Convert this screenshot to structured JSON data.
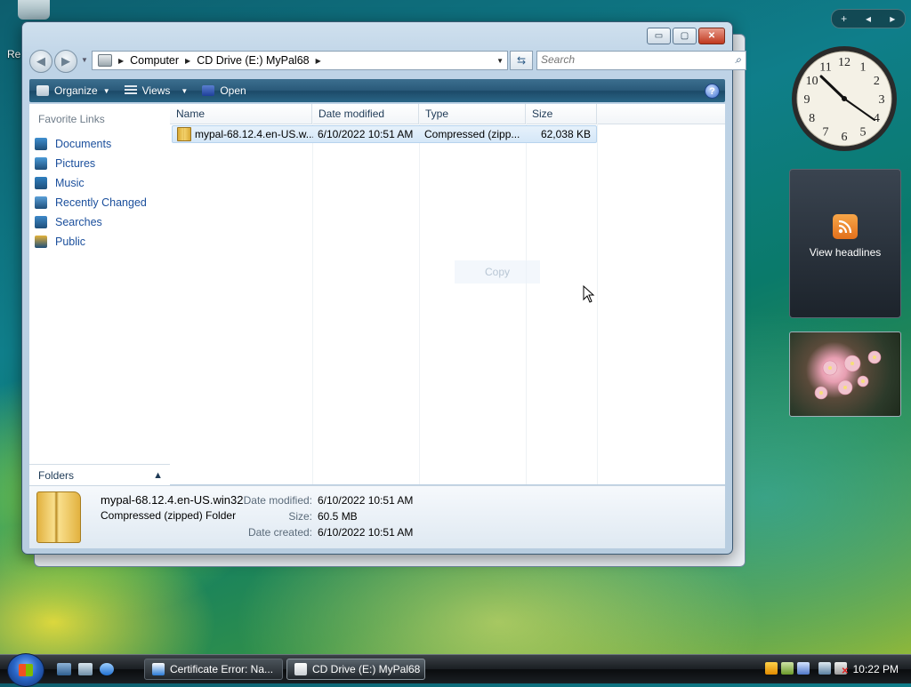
{
  "window": {
    "minimize_label": "▭",
    "maximize_label": "▢",
    "close_label": "✕"
  },
  "address": {
    "segments": [
      "Computer",
      "CD Drive (E:) MyPal68"
    ]
  },
  "search": {
    "placeholder": "Search"
  },
  "toolbar": {
    "organize_label": "Organize",
    "views_label": "Views",
    "open_label": "Open",
    "help_label": "?"
  },
  "favorites": {
    "title": "Favorite Links",
    "items": [
      {
        "label": "Documents",
        "color": "#3f8fcf"
      },
      {
        "label": "Pictures",
        "color": "#4a9ad6"
      },
      {
        "label": "Music",
        "color": "#2f7fc0"
      },
      {
        "label": "Recently Changed",
        "color": "#5aa0d8"
      },
      {
        "label": "Searches",
        "color": "#3d88c8"
      },
      {
        "label": "Public",
        "color": "#e3b23a"
      }
    ],
    "folders_label": "Folders"
  },
  "columns": {
    "name": "Name",
    "date": "Date modified",
    "type": "Type",
    "size": "Size"
  },
  "files": [
    {
      "name": "mypal-68.12.4.en-US.w...",
      "date": "6/10/2022 10:51 AM",
      "type": "Compressed (zipp...",
      "size": "62,038 KB"
    }
  ],
  "ghost_copy_label": "Copy",
  "details": {
    "name": "mypal-68.12.4.en-US.win32",
    "type": "Compressed (zipped) Folder",
    "modified_key": "Date modified:",
    "modified_val": "6/10/2022 10:51 AM",
    "size_key": "Size:",
    "size_val": "60.5 MB",
    "created_key": "Date created:",
    "created_val": "6/10/2022 10:51 AM"
  },
  "desktop": {
    "label_fragment": "Re"
  },
  "gadgets": {
    "bar": [
      "+",
      "◂",
      "▸"
    ],
    "feed_label": "View headlines",
    "clock_numbers": [
      "12",
      "1",
      "2",
      "3",
      "4",
      "5",
      "6",
      "7",
      "8",
      "9",
      "10",
      "11"
    ]
  },
  "taskbar": {
    "tasks": [
      {
        "label": "Certificate Error: Na...",
        "icon_color": "#2b7bd6"
      },
      {
        "label": "CD Drive (E:) MyPal68",
        "icon_color": "#c8ced3"
      }
    ],
    "time": "10:22 PM"
  },
  "colors": {
    "link": "#1b4f9c",
    "selection": "#d5e7f8",
    "toolbar": "#2a5a7a"
  }
}
